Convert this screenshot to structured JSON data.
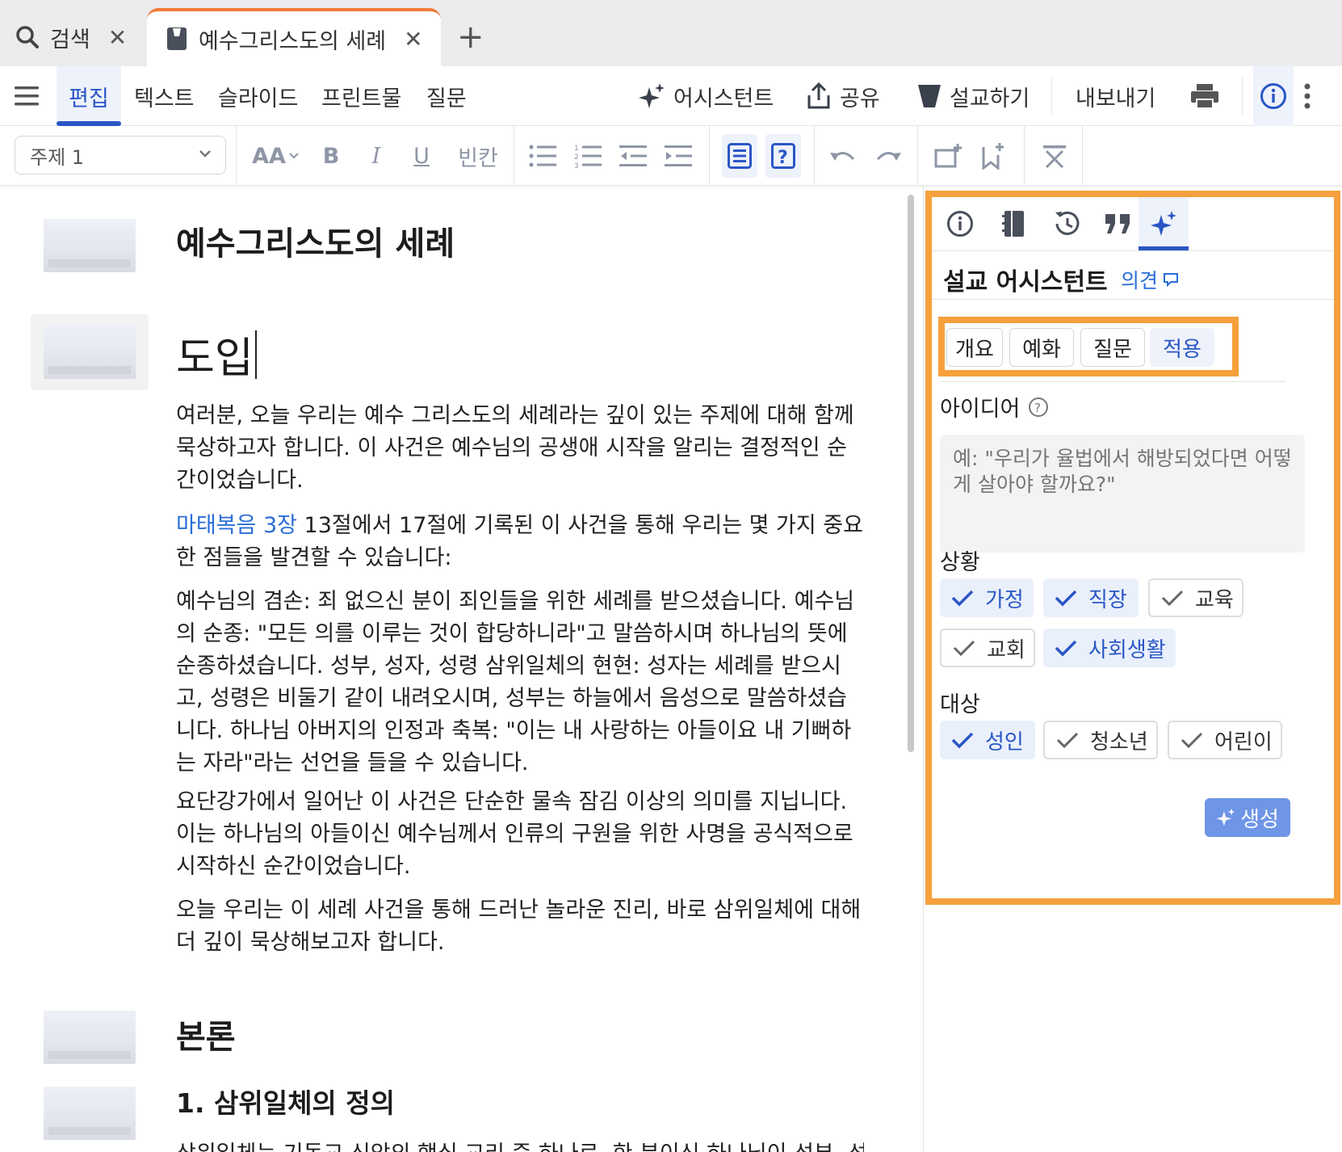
{
  "tabs": {
    "search_label": "검색",
    "doc_label": "예수그리스도의 세례",
    "close_glyph": "✕",
    "new_glyph": "+"
  },
  "menu": {
    "edit": "편집",
    "text": "텍스트",
    "slide": "슬라이드",
    "handout": "프린트물",
    "question": "질문",
    "assistant": "어시스턴트",
    "share": "공유",
    "preach": "설교하기",
    "export": "내보내기"
  },
  "format": {
    "style_value": "주제 1",
    "blank": "빈칸",
    "bold": "B",
    "italic": "I",
    "underline": "U",
    "font_size": "AA"
  },
  "document": {
    "title": "예수그리스도의 세례",
    "intro_heading": "도입",
    "p1": "여러분, 오늘 우리는 예수 그리스도의 세례라는 깊이 있는 주제에 대해 함께 묵상하고자 합니다. 이 사건은 예수님의 공생애 시작을 알리는 결정적인 순간이었습니다.",
    "p2_link": "마태복음 3장",
    "p2_rest": " 13절에서 17절에 기록된 이 사건을 통해 우리는 몇 가지 중요한 점들을 발견할 수 있습니다:",
    "p3": "예수님의 겸손: 죄 없으신 분이 죄인들을 위한 세례를 받으셨습니다. 예수님의 순종: \"모든 의를 이루는 것이 합당하니라\"고 말씀하시며 하나님의 뜻에 순종하셨습니다. 성부, 성자, 성령 삼위일체의 현현: 성자는 세례를 받으시고, 성령은 비둘기 같이 내려오시며, 성부는 하늘에서 음성으로 말씀하셨습니다. 하나님 아버지의 인정과 축복: \"이는 내 사랑하는 아들이요 내 기뻐하는 자라\"라는 선언을 들을 수 있습니다.",
    "p4": "요단강가에서 일어난 이 사건은 단순한 물속 잠김 이상의 의미를 지닙니다. 이는 하나님의 아들이신 예수님께서 인류의 구원을 위한 사명을 공식적으로 시작하신 순간이었습니다.",
    "p5": "오늘 우리는 이 세례 사건을 통해 드러난 놀라운 진리, 바로 삼위일체에 대해 더 깊이 묵상해보고자 합니다.",
    "body_heading": "본론",
    "sub_heading": "1. 삼위일체의 정의",
    "p6_partial": "삼위일체는 기독교 신앙의 핵심 교리 중 하나로, 한 분이신 하나님이 성부, 성"
  },
  "panel": {
    "title": "설교 어시스턴트",
    "feedback": "의견",
    "segments": [
      "개요",
      "예화",
      "질문",
      "적용"
    ],
    "idea_label": "아이디어",
    "idea_placeholder": "예: \"우리가 율법에서 해방되었다면 어떻게 살아야 할까요?\"",
    "situation_label": "상황",
    "situations": [
      {
        "label": "가정",
        "on": true
      },
      {
        "label": "직장",
        "on": true
      },
      {
        "label": "교육",
        "on": false
      },
      {
        "label": "교회",
        "on": false
      },
      {
        "label": "사회생활",
        "on": true
      }
    ],
    "audience_label": "대상",
    "audiences": [
      {
        "label": "성인",
        "on": true
      },
      {
        "label": "청소년",
        "on": false
      },
      {
        "label": "어린이",
        "on": false
      }
    ],
    "generate": "생성"
  },
  "colors": {
    "accent": "#2a56c6",
    "highlight": "#f5a03c",
    "tab_indicator": "#f07a3a"
  }
}
